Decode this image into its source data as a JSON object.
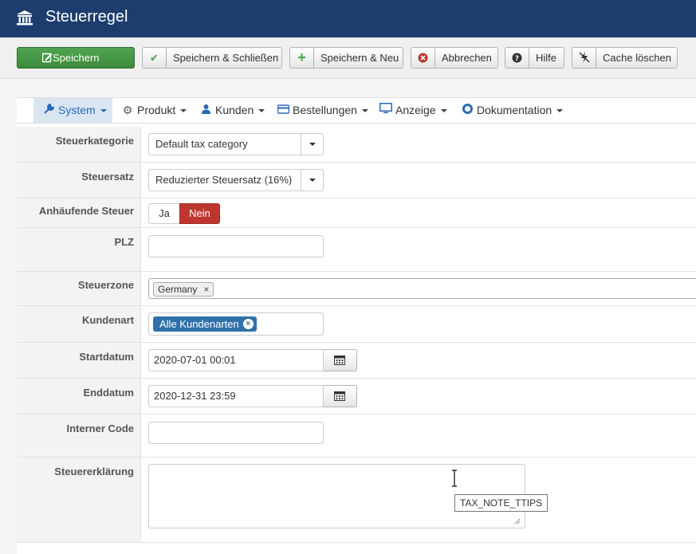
{
  "app": {
    "title": "Steuerregel"
  },
  "toolbar": {
    "save": "Speichern",
    "save_close": "Speichern & Schließen",
    "save_new": "Speichern & Neu",
    "cancel": "Abbrechen",
    "help": "Hilfe",
    "clear_cache": "Cache löschen"
  },
  "nav": [
    {
      "label": "System",
      "icon": "wrench-icon"
    },
    {
      "label": "Produkt",
      "icon": "cogs-icon"
    },
    {
      "label": "Kunden",
      "icon": "user-icon"
    },
    {
      "label": "Bestellungen",
      "icon": "credit-card-icon"
    },
    {
      "label": "Anzeige",
      "icon": "monitor-icon"
    },
    {
      "label": "Dokumentation",
      "icon": "lifebuoy-icon"
    }
  ],
  "form": {
    "tax_category": {
      "label": "Steuerkategorie",
      "value": "Default tax category"
    },
    "tax_rate": {
      "label": "Steuersatz",
      "value": "Reduzierter Steuersatz (16%)"
    },
    "cumulative": {
      "label": "Anhäufende Steuer",
      "yes": "Ja",
      "no": "Nein",
      "selected": "Nein"
    },
    "zip": {
      "label": "PLZ",
      "value": ""
    },
    "tax_zone": {
      "label": "Steuerzone",
      "chip": "Germany",
      "remove": "×"
    },
    "customer_type": {
      "label": "Kundenart",
      "chip": "Alle Kundenarten",
      "remove": "×"
    },
    "start_date": {
      "label": "Startdatum",
      "value": "2020-07-01 00:01"
    },
    "end_date": {
      "label": "Enddatum",
      "value": "2020-12-31 23:59"
    },
    "internal_code": {
      "label": "Interner Code",
      "value": ""
    },
    "tax_note": {
      "label": "Steuererklärung",
      "value": "",
      "tooltip": "TAX_NOTE_TTIPS"
    }
  },
  "colors": {
    "header_bg": "#1c3d6e",
    "save_green": "#46a546",
    "nein_red": "#bd362f",
    "chip_blue": "#3071a9",
    "nav_active_bg": "#d9e6f2"
  }
}
